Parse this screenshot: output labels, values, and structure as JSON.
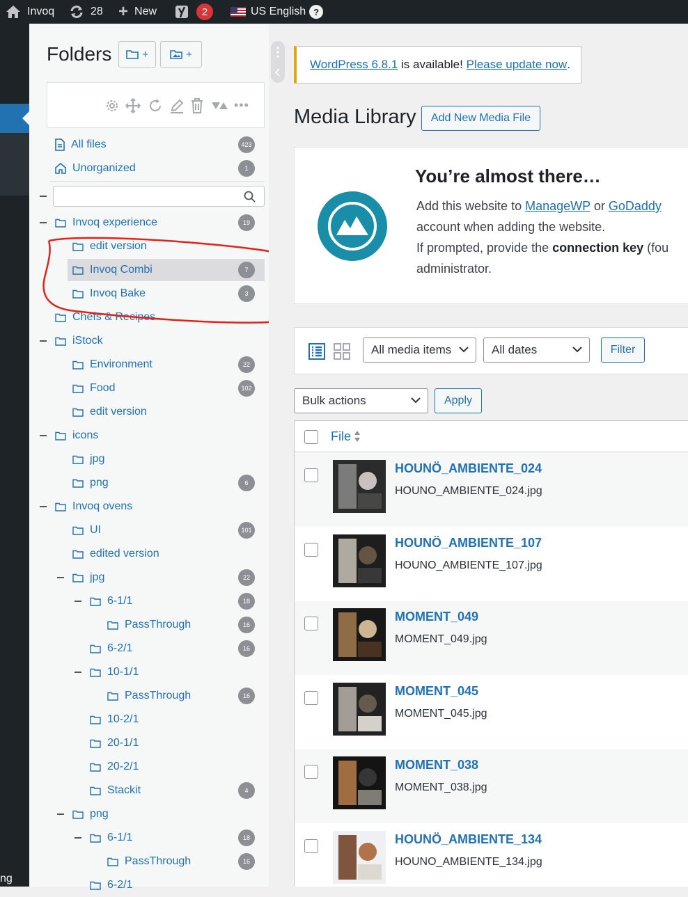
{
  "admin_bar": {
    "site_name": "Invoq",
    "updates_count": "28",
    "new_label": "New",
    "yoast_count": "2",
    "language": "US English",
    "help_label": "?",
    "left_partial_text": "ng"
  },
  "folders": {
    "title": "Folders",
    "new_folder_label": "+",
    "new_gallery_label": "+",
    "search_placeholder": "",
    "all_files": {
      "label": "All files",
      "count": "423"
    },
    "unorganized": {
      "label": "Unorganized",
      "count": "1"
    },
    "tree": [
      {
        "label": "Invoq experience",
        "count": "19",
        "level": 0,
        "toggle": true
      },
      {
        "label": "edit version",
        "count": "",
        "level": 1,
        "toggle": false
      },
      {
        "label": "Invoq Combi",
        "count": "7",
        "level": 1,
        "toggle": false,
        "selected": true
      },
      {
        "label": "Invoq Bake",
        "count": "3",
        "level": 1,
        "toggle": false
      },
      {
        "label": "Chefs & Recipes",
        "count": "",
        "level": 0,
        "toggle": false
      },
      {
        "label": "iStock",
        "count": "",
        "level": 0,
        "toggle": true
      },
      {
        "label": "Environment",
        "count": "22",
        "level": 1,
        "toggle": false
      },
      {
        "label": "Food",
        "count": "102",
        "level": 1,
        "toggle": false
      },
      {
        "label": "edit version",
        "count": "",
        "level": 1,
        "toggle": false
      },
      {
        "label": "icons",
        "count": "",
        "level": 0,
        "toggle": true
      },
      {
        "label": "jpg",
        "count": "",
        "level": 1,
        "toggle": false
      },
      {
        "label": "png",
        "count": "6",
        "level": 1,
        "toggle": false
      },
      {
        "label": "Invoq ovens",
        "count": "",
        "level": 0,
        "toggle": true
      },
      {
        "label": "UI",
        "count": "101",
        "level": 1,
        "toggle": false
      },
      {
        "label": "edited version",
        "count": "",
        "level": 1,
        "toggle": false
      },
      {
        "label": "jpg",
        "count": "22",
        "level": 1,
        "toggle": true
      },
      {
        "label": "6-1/1",
        "count": "18",
        "level": 2,
        "toggle": true
      },
      {
        "label": "PassThrough",
        "count": "16",
        "level": 3,
        "toggle": false
      },
      {
        "label": "6-2/1",
        "count": "16",
        "level": 2,
        "toggle": false
      },
      {
        "label": "10-1/1",
        "count": "",
        "level": 2,
        "toggle": true
      },
      {
        "label": "PassThrough",
        "count": "16",
        "level": 3,
        "toggle": false
      },
      {
        "label": "10-2/1",
        "count": "",
        "level": 2,
        "toggle": false
      },
      {
        "label": "20-1/1",
        "count": "",
        "level": 2,
        "toggle": false
      },
      {
        "label": "20-2/1",
        "count": "",
        "level": 2,
        "toggle": false
      },
      {
        "label": "Stackit",
        "count": "4",
        "level": 2,
        "toggle": false
      },
      {
        "label": "png",
        "count": "",
        "level": 1,
        "toggle": true
      },
      {
        "label": "6-1/1",
        "count": "18",
        "level": 2,
        "toggle": true
      },
      {
        "label": "PassThrough",
        "count": "16",
        "level": 3,
        "toggle": false
      },
      {
        "label": "6-2/1",
        "count": "",
        "level": 2,
        "toggle": false
      }
    ]
  },
  "notice": {
    "version_link": "WordPress 6.8.1",
    "middle_text": " is available! ",
    "update_link": "Please update now",
    "end_text": "."
  },
  "page": {
    "title": "Media Library",
    "add_new_label": "Add New Media File"
  },
  "managewp": {
    "heading": "You’re almost there…",
    "line1_a": "Add this website to ",
    "link1": "ManageWP",
    "line1_b": " or ",
    "link2": "GoDaddy",
    "line2": "account when adding the website.",
    "line3_a": "If prompted, provide the ",
    "line3_b": "connection key",
    "line3_c": " (fou",
    "line4": "administrator."
  },
  "filters": {
    "media_type": "All media items",
    "dates": "All dates",
    "filter_button": "Filter",
    "bulk_actions": "Bulk actions",
    "apply_button": "Apply"
  },
  "table": {
    "file_header": "File",
    "rows": [
      {
        "title": "HOUNÖ_AMBIENTE_024",
        "filename": "HOUNO_AMBIENTE_024.jpg"
      },
      {
        "title": "HOUNÖ_AMBIENTE_107",
        "filename": "HOUNO_AMBIENTE_107.jpg"
      },
      {
        "title": "MOMENT_049",
        "filename": "MOMENT_049.jpg"
      },
      {
        "title": "MOMENT_045",
        "filename": "MOMENT_045.jpg"
      },
      {
        "title": "MOMENT_038",
        "filename": "MOMENT_038.jpg"
      },
      {
        "title": "HOUNÖ_AMBIENTE_134",
        "filename": "HOUNO_AMBIENTE_134.jpg"
      }
    ]
  },
  "colors": {
    "admin_bar": "#1d2327",
    "accent": "#2271b1",
    "badge": "#8c8f94",
    "notice_warning": "#dba617",
    "managewp_logo": "#1a8ea8",
    "annotation": "#e0241b"
  }
}
